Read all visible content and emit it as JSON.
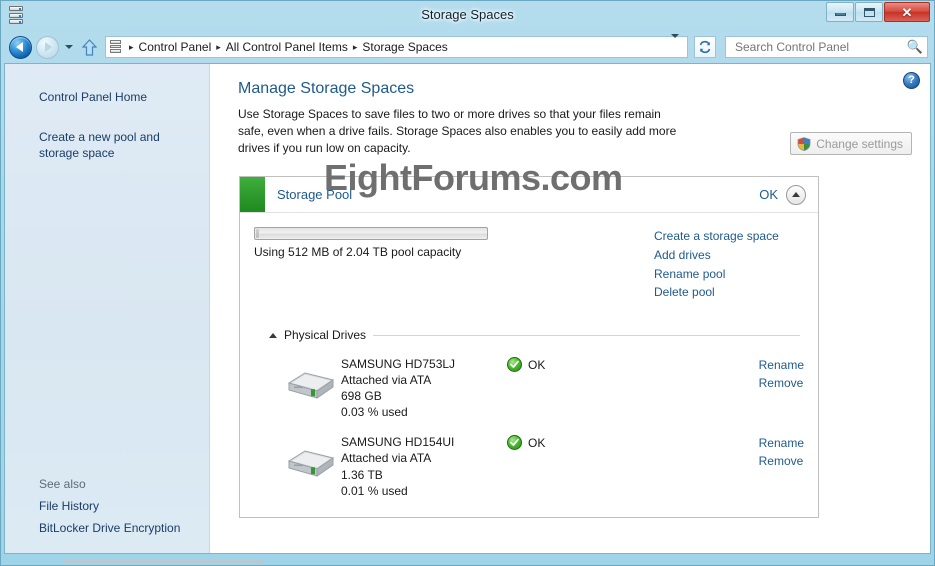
{
  "window": {
    "title": "Storage Spaces",
    "icon": "storage-server-icon",
    "buttons": {
      "minimize": "–",
      "maximize": "□",
      "close": "✕"
    }
  },
  "nav": {
    "back_icon": "back-arrow-icon",
    "forward_icon": "forward-arrow-icon",
    "history_caret": "chevron-down-icon",
    "up_icon": "up-arrow-icon",
    "breadcrumb": [
      "Control Panel",
      "All Control Panel Items",
      "Storage Spaces"
    ],
    "breadcrumb_separator": "▸",
    "address_caret_icon": "chevron-down-icon",
    "refresh_icon": "refresh-icon",
    "search": {
      "placeholder": "Search Control Panel",
      "value": "",
      "icon": "search-icon"
    }
  },
  "sidebar": {
    "links": [
      {
        "label": "Control Panel Home"
      },
      {
        "label": "Create a new pool and storage space"
      }
    ],
    "see_also_title": "See also",
    "see_also": [
      {
        "label": "File History"
      },
      {
        "label": "BitLocker Drive Encryption"
      }
    ]
  },
  "main": {
    "help_label": "?",
    "title": "Manage Storage Spaces",
    "description": "Use Storage Spaces to save files to two or more drives so that your files remain safe, even when a drive fails. Storage Spaces also enables you to easily add more drives if you run low on capacity.",
    "change_settings_label": "Change settings",
    "change_settings_icon": "uac-shield-icon",
    "watermark": "EightForums.com"
  },
  "pool": {
    "name": "Storage Pool",
    "status": "OK",
    "status_color": "#2f9a2d",
    "collapse_icon": "chevron-up-icon",
    "capacity_text": "Using 512 MB of 2.04 TB pool capacity",
    "used_percent": 1.2,
    "links": [
      {
        "label": "Create a storage space"
      },
      {
        "label": "Add drives"
      },
      {
        "label": "Rename pool"
      },
      {
        "label": "Delete pool"
      }
    ]
  },
  "physical_drives": {
    "section_label": "Physical Drives",
    "section_icon": "chevron-up-icon",
    "drives": [
      {
        "name": "SAMSUNG HD753LJ",
        "attachment": "Attached via ATA",
        "capacity": "698 GB",
        "used": "0.03 % used",
        "status": "OK",
        "status_icon": "green-check-icon",
        "drive_icon": "hard-drive-icon",
        "actions": [
          {
            "label": "Rename"
          },
          {
            "label": "Remove"
          }
        ]
      },
      {
        "name": "SAMSUNG HD154UI",
        "attachment": "Attached via ATA",
        "capacity": "1.36 TB",
        "used": "0.01 % used",
        "status": "OK",
        "status_icon": "green-check-icon",
        "drive_icon": "hard-drive-icon",
        "actions": [
          {
            "label": "Rename"
          },
          {
            "label": "Remove"
          }
        ]
      }
    ]
  }
}
